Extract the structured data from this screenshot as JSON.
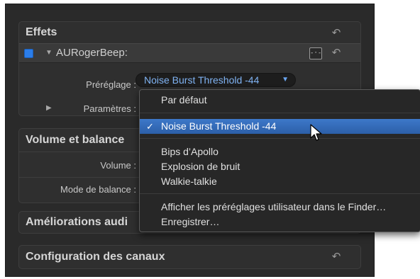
{
  "sections": {
    "effects": {
      "title": "Effets",
      "effect_name": "AURogerBeep:",
      "effect_icon_glyph": "-·-",
      "preset_label": "Préréglage :",
      "preset_value": "Noise Burst Threshold -44",
      "params_label": "Paramètres :"
    },
    "volume": {
      "title": "Volume et balance",
      "volume_label": "Volume :",
      "pan_mode_label": "Mode de balance :"
    },
    "enhancements": {
      "title": "Améliorations audi"
    },
    "channels": {
      "title": "Configuration des canaux"
    }
  },
  "preset_menu": {
    "items": [
      {
        "label": "Par défaut",
        "selected": false
      },
      {
        "label": "Noise Burst Threshold -44",
        "selected": true,
        "check": "✓"
      },
      {
        "label": "Bips d’Apollo",
        "selected": false
      },
      {
        "label": "Explosion de bruit",
        "selected": false
      },
      {
        "label": "Walkie-talkie",
        "selected": false
      },
      {
        "label": "Afficher les préréglages utilisateur dans le Finder…",
        "selected": false
      },
      {
        "label": "Enregistrer…",
        "selected": false
      }
    ]
  },
  "icons": {
    "reset": "reset-arrow-icon",
    "enable_checkbox": "blue-checkbox",
    "disclosure_open": "triangle-down-icon",
    "disclosure_closed": "triangle-right-icon",
    "popup_arrow": "triangle-down-icon",
    "pointer": "mouse-pointer-icon"
  },
  "colors": {
    "accent": "#2b7de9",
    "selection": "#3d78c9",
    "preset_text": "#7fb2f2"
  }
}
